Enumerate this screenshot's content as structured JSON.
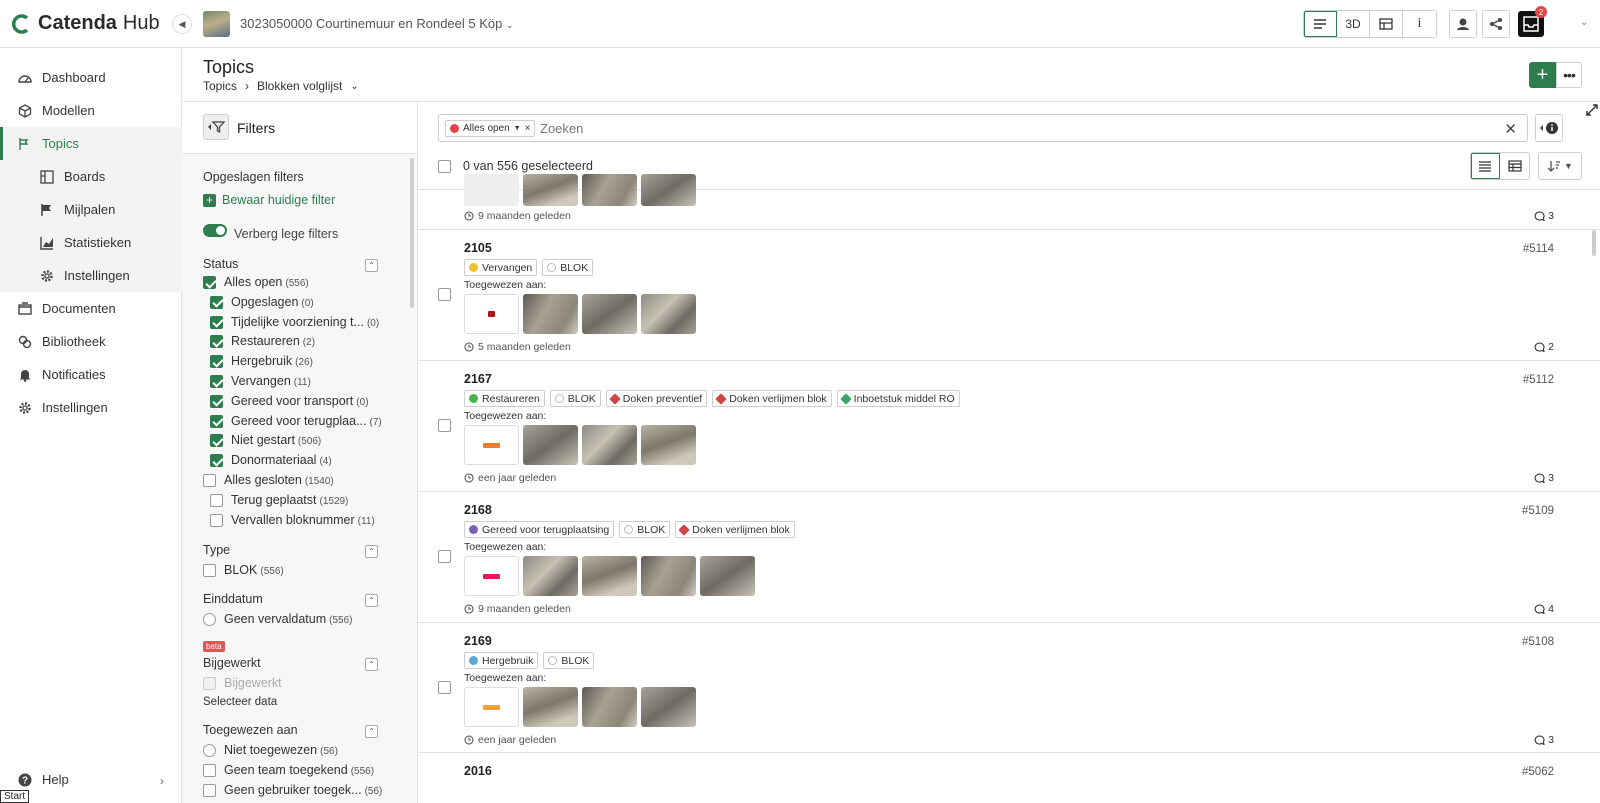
{
  "app": {
    "brand_main": "Catenda",
    "brand_sub": "Hub",
    "project_name": "3023050000 Courtinemuur en Rondeel 5 Köp"
  },
  "toolbar": {
    "btn_3d": "3D",
    "btn_info": "i",
    "inbox_count": "2"
  },
  "sidebar": {
    "items": [
      {
        "label": "Dashboard",
        "icon": "dashboard-icon"
      },
      {
        "label": "Modellen",
        "icon": "cube-icon"
      },
      {
        "label": "Topics",
        "icon": "topics-icon"
      },
      {
        "label": "Boards",
        "icon": "board-icon"
      },
      {
        "label": "Mijlpalen",
        "icon": "flag-icon"
      },
      {
        "label": "Statistieken",
        "icon": "chart-icon"
      },
      {
        "label": "Instellingen",
        "icon": "gear-icon"
      },
      {
        "label": "Documenten",
        "icon": "folder-icon"
      },
      {
        "label": "Bibliotheek",
        "icon": "library-icon"
      },
      {
        "label": "Notificaties",
        "icon": "bell-icon"
      },
      {
        "label": "Instellingen",
        "icon": "gear-icon"
      }
    ],
    "help": "Help",
    "start": "Start"
  },
  "header": {
    "title": "Topics",
    "crumb_root": "Topics",
    "crumb_current": "Blokken volglijst"
  },
  "filters": {
    "title": "Filters",
    "saved_title": "Opgeslagen filters",
    "save_current": "Bewaar huidige filter",
    "hide_empty": "Verberg lege filters",
    "status_title": "Status",
    "status": [
      {
        "label": "Alles open",
        "count": "(556)",
        "checked": true
      },
      {
        "label": "Opgeslagen",
        "count": "(0)",
        "checked": true
      },
      {
        "label": "Tijdelijke voorziening t...",
        "count": "(0)",
        "checked": true
      },
      {
        "label": "Restaureren",
        "count": "(2)",
        "checked": true
      },
      {
        "label": "Hergebruik",
        "count": "(26)",
        "checked": true
      },
      {
        "label": "Vervangen",
        "count": "(11)",
        "checked": true
      },
      {
        "label": "Gereed voor transport",
        "count": "(0)",
        "checked": true
      },
      {
        "label": "Gereed voor terugplaa...",
        "count": "(7)",
        "checked": true
      },
      {
        "label": "Niet gestart",
        "count": "(506)",
        "checked": true
      },
      {
        "label": "Donormateriaal",
        "count": "(4)",
        "checked": true
      },
      {
        "label": "Alles gesloten",
        "count": "(1540)",
        "checked": false
      },
      {
        "label": "Terug geplaatst",
        "count": "(1529)",
        "checked": false
      },
      {
        "label": "Vervallen bloknummer",
        "count": "(11)",
        "checked": false
      }
    ],
    "type_title": "Type",
    "type_item": {
      "label": "BLOK",
      "count": "(556)"
    },
    "due_title": "Einddatum",
    "due_item": {
      "label": "Geen vervaldatum",
      "count": "(556)"
    },
    "beta": "beta",
    "updated_title": "Bijgewerkt",
    "updated_item": "Bijgewerkt",
    "select_data": "Selecteer data",
    "assigned_title": "Toegewezen aan",
    "assigned": [
      {
        "label": "Niet toegewezen",
        "count": "(56)"
      },
      {
        "label": "Geen team toegekend",
        "count": "(556)"
      },
      {
        "label": "Geen gebruiker toegek...",
        "count": "(56)"
      }
    ]
  },
  "search": {
    "chip": "Alles open",
    "placeholder": "Zoeken"
  },
  "selection": {
    "text": "0 van 556 geselecteerd"
  },
  "topics": [
    {
      "title": "",
      "id": "",
      "date": "9 maanden geleden",
      "comments": "3",
      "tags": [],
      "assign": ""
    },
    {
      "title": "2105",
      "id": "#5114",
      "date": "5 maanden geleden",
      "comments": "2",
      "assign": "Toegewezen aan:",
      "tags": [
        {
          "text": "Vervangen",
          "kind": "status",
          "color": "#f0c030"
        },
        {
          "text": "BLOK",
          "kind": "type"
        }
      ]
    },
    {
      "title": "2167",
      "id": "#5112",
      "date": "een jaar geleden",
      "comments": "3",
      "assign": "Toegewezen aan:",
      "tags": [
        {
          "text": "Restaureren",
          "kind": "status",
          "color": "#4caf50"
        },
        {
          "text": "BLOK",
          "kind": "type"
        },
        {
          "text": "Doken preventief",
          "kind": "label",
          "color": "#d04545"
        },
        {
          "text": "Doken verlijmen blok",
          "kind": "label",
          "color": "#d04545"
        },
        {
          "text": "Inboetstuk middel RO",
          "kind": "label",
          "color": "#3aa66a"
        }
      ]
    },
    {
      "title": "2168",
      "id": "#5109",
      "date": "9 maanden geleden",
      "comments": "4",
      "assign": "Toegewezen aan:",
      "tags": [
        {
          "text": "Gereed voor terugplaatsing",
          "kind": "status",
          "color": "#7b5fb5"
        },
        {
          "text": "BLOK",
          "kind": "type"
        },
        {
          "text": "Doken verlijmen blok",
          "kind": "label",
          "color": "#d04545"
        }
      ]
    },
    {
      "title": "2169",
      "id": "#5108",
      "date": "een jaar geleden",
      "comments": "3",
      "assign": "Toegewezen aan:",
      "tags": [
        {
          "text": "Hergebruik",
          "kind": "status",
          "color": "#5ba8d8"
        },
        {
          "text": "BLOK",
          "kind": "type"
        }
      ]
    },
    {
      "title": "2016",
      "id": "#5062",
      "date": "",
      "comments": "",
      "tags": [],
      "assign": ""
    }
  ],
  "colors": {
    "accent": "#2e7d4f",
    "chip_red": "#e04848"
  }
}
